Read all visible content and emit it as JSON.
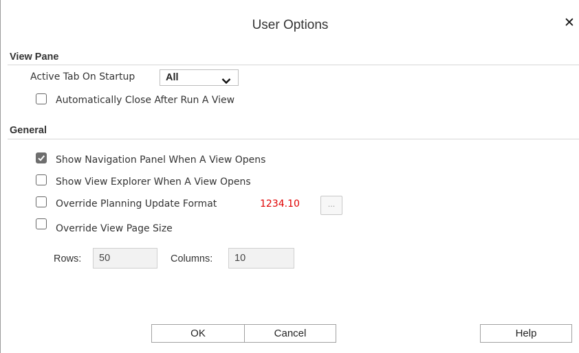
{
  "dialog": {
    "title": "User Options",
    "close_symbol": "✕"
  },
  "view_pane": {
    "heading": "View Pane",
    "active_tab_label": "Active Tab On Startup",
    "active_tab_value": "All",
    "auto_close_label": "Automatically Close After Run A View",
    "auto_close_checked": false
  },
  "general": {
    "heading": "General",
    "show_nav_label": "Show Navigation Panel When A View Opens",
    "show_nav_checked": true,
    "show_explorer_label": "Show View Explorer When A View Opens",
    "show_explorer_checked": false,
    "override_format_label": "Override Planning Update Format",
    "override_format_checked": false,
    "format_sample": "1234.10",
    "format_button_label": "...",
    "override_page_size_label": "Override View Page Size",
    "override_page_size_checked": false,
    "rows_label": "Rows:",
    "rows_value": "50",
    "columns_label": "Columns:",
    "columns_value": "10"
  },
  "footer": {
    "ok_label": "OK",
    "cancel_label": "Cancel",
    "help_label": "Help"
  },
  "colors": {
    "format_sample": "#e00000",
    "checked_box": "#6e6e6e"
  }
}
